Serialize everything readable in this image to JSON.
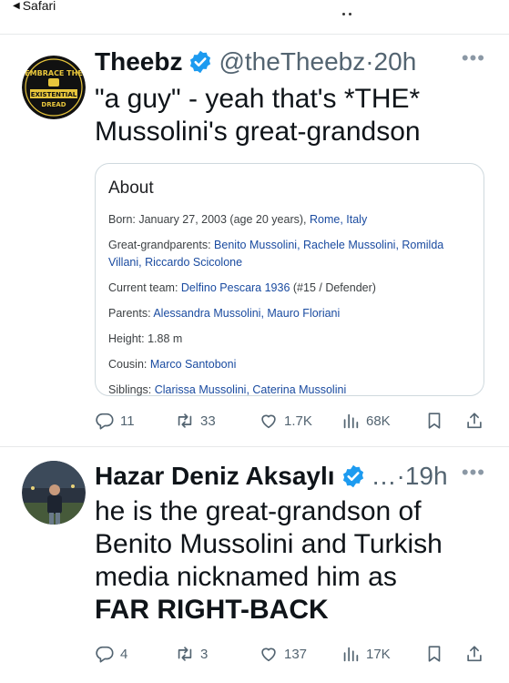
{
  "status_bar": {
    "back_app": "Safari"
  },
  "tweets": [
    {
      "name": "Theebz",
      "handle": "@theTheebz",
      "separator": "·",
      "time": "20h",
      "avatar_text": {
        "top": "EMBRACE THE",
        "bottom": "EXISTENTIAL DREAD"
      },
      "text": "\"a guy\" - yeah that's *THE* Mussolini's great-grandson",
      "card": {
        "title": "About",
        "rows": [
          {
            "label": "Born: ",
            "value": "January 27, 2003 (age 20 years), ",
            "link": "Rome, Italy"
          },
          {
            "label": "Great-grandparents: ",
            "value": "",
            "link": "Benito Mussolini, Rachele Mussolini, Romilda Villani, Riccardo Scicolone"
          },
          {
            "label": "Current team: ",
            "value": "",
            "link": "Delfino Pescara 1936",
            "after": " (#15 / Defender)"
          },
          {
            "label": "Parents: ",
            "value": "",
            "link": "Alessandra Mussolini, Mauro Floriani"
          },
          {
            "label": "Height: ",
            "value": "1.88 m",
            "link": ""
          },
          {
            "label": "Cousin: ",
            "value": "",
            "link": "Marco Santoboni"
          },
          {
            "label": "Siblings: ",
            "value": "",
            "link": "Clarissa Mussolini, Caterina Mussolini"
          }
        ]
      },
      "actions": {
        "replies": "11",
        "retweets": "33",
        "likes": "1.7K",
        "views": "68K"
      }
    },
    {
      "name": "Hazar Deniz Aksaylı",
      "handle": "…",
      "separator": "·",
      "time": "19h",
      "text": "he is the great-grandson of Benito Mussolini and Turkish media nicknamed him as",
      "text_emph": "FAR RIGHT-BACK",
      "actions": {
        "replies": "4",
        "retweets": "3",
        "likes": "137",
        "views": "17K"
      }
    }
  ],
  "colors": {
    "verified": "#1d9bf0",
    "link": "#1a4ba0",
    "secondary": "#536471"
  },
  "icons": [
    "verified-badge-icon",
    "reply-icon",
    "retweet-icon",
    "like-icon",
    "views-icon",
    "bookmark-icon",
    "share-icon",
    "more-icon"
  ]
}
